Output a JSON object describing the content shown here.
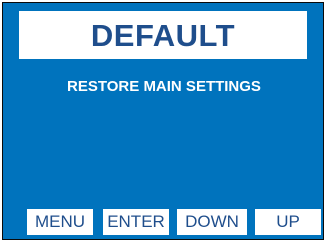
{
  "screen": {
    "title": "DEFAULT",
    "subtitle": "RESTORE MAIN SETTINGS"
  },
  "softkeys": {
    "menu": "MENU",
    "enter": "ENTER",
    "down": "DOWN",
    "up": "UP"
  },
  "colors": {
    "background": "#0073bd",
    "title_text": "#1f4e8c",
    "key_text": "#1f4e8c",
    "white": "#ffffff"
  }
}
